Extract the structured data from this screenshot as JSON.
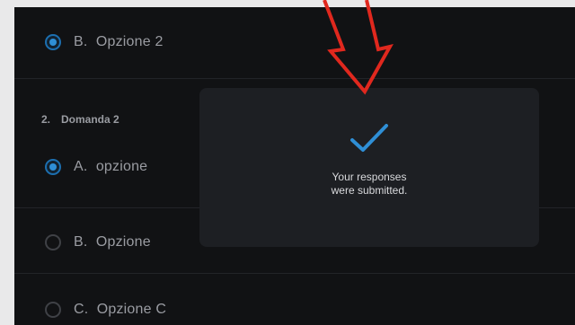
{
  "survey": {
    "q1_option_b": {
      "letter": "B.",
      "text": "Opzione 2",
      "selected": true
    },
    "q2": {
      "number": "2.",
      "title": "Domanda 2",
      "options": [
        {
          "letter": "A.",
          "text": "opzione",
          "selected": true
        },
        {
          "letter": "B.",
          "text": "Opzione",
          "selected": false
        },
        {
          "letter": "C.",
          "text": "Opzione C",
          "selected": false
        }
      ]
    }
  },
  "toast": {
    "icon": "checkmark-icon",
    "line1": "Your responses",
    "line2": "were submitted."
  },
  "annotation": {
    "icon": "red-arrow-down-icon",
    "color": "#e0281e"
  },
  "colors": {
    "accent": "#2f8fd6",
    "background": "#111214",
    "toast": "#1d1f23"
  }
}
